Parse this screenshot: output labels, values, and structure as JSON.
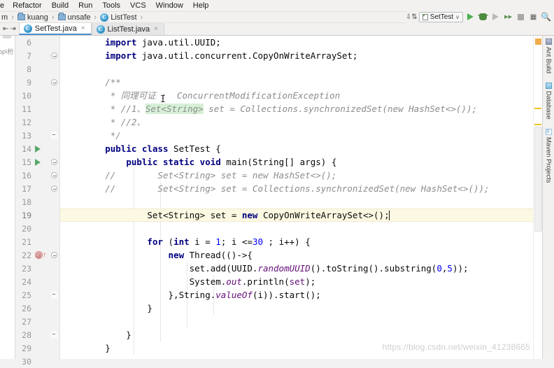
{
  "menubar": {
    "items": [
      {
        "label": "e",
        "clipped": true
      },
      {
        "label": "Refactor"
      },
      {
        "label": "Build"
      },
      {
        "label": "Run"
      },
      {
        "label": "Tools"
      },
      {
        "label": "VCS"
      },
      {
        "label": "Window"
      },
      {
        "label": "Help"
      }
    ]
  },
  "breadcrumb": {
    "items": [
      {
        "label": "m",
        "icon": "none"
      },
      {
        "label": "kuang",
        "icon": "folder-icon"
      },
      {
        "label": "unsafe",
        "icon": "folder-icon"
      },
      {
        "label": "ListTest",
        "icon": "class-icon"
      }
    ]
  },
  "tabs": {
    "items": [
      {
        "label": "SetTest.java",
        "active": true,
        "close": "×"
      },
      {
        "label": "ListTest.java",
        "active": false,
        "close": "×"
      }
    ]
  },
  "run_toolbar": {
    "sort_icon": "sort-descending-icon",
    "config_name": "SetTest",
    "config_chevron": "∨",
    "run_label": "run-icon",
    "debug_label": "debug-icon",
    "run_with_coverage": "coverage-icon",
    "profile": "profile-icon",
    "stop": "stop-icon",
    "layout": "layout-icon",
    "search": "search-icon"
  },
  "left_stripe": {
    "ghost_text": "op\\桁"
  },
  "editor": {
    "lines": [
      {
        "n": "6",
        "gutter": {
          "run": false,
          "fold": false,
          "overridden": false
        },
        "current": false,
        "tokens": [
          {
            "t": "        ",
            "c": "plain"
          },
          {
            "t": "import",
            "c": "kw"
          },
          {
            "t": " java.util.UUID;",
            "c": "plain"
          }
        ]
      },
      {
        "n": "7",
        "gutter": {
          "run": false,
          "fold": true,
          "overridden": false
        },
        "current": false,
        "tokens": [
          {
            "t": "        ",
            "c": "plain"
          },
          {
            "t": "import",
            "c": "kw"
          },
          {
            "t": " java.util.concurrent.CopyOnWriteArraySet;",
            "c": "plain"
          }
        ]
      },
      {
        "n": "8",
        "gutter": {
          "run": false,
          "fold": false,
          "overridden": false
        },
        "current": false,
        "tokens": []
      },
      {
        "n": "9",
        "gutter": {
          "run": false,
          "fold": true,
          "overridden": false
        },
        "current": false,
        "tokens": [
          {
            "t": "        /**",
            "c": "cmt"
          }
        ]
      },
      {
        "n": "10",
        "gutter": {
          "run": false,
          "fold": false,
          "overridden": false
        },
        "current": false,
        "tokens": [
          {
            "t": "         * 同理可证 :  ConcurrentModificationException",
            "c": "cmt"
          }
        ]
      },
      {
        "n": "11",
        "gutter": {
          "run": false,
          "fold": false,
          "overridden": false
        },
        "current": false,
        "tokens": [
          {
            "t": "         * //1、",
            "c": "cmt"
          },
          {
            "t": "Set<String>",
            "c": "cmt-hl"
          },
          {
            "t": " set = Collections.synchronizedSet(new HashSet<>());",
            "c": "cmt"
          }
        ]
      },
      {
        "n": "12",
        "gutter": {
          "run": false,
          "fold": false,
          "overridden": false
        },
        "current": false,
        "tokens": [
          {
            "t": "         * //2、",
            "c": "cmt"
          }
        ]
      },
      {
        "n": "13",
        "gutter": {
          "run": false,
          "fold": "tip",
          "overridden": false
        },
        "current": false,
        "tokens": [
          {
            "t": "         */",
            "c": "cmt"
          }
        ]
      },
      {
        "n": "14",
        "gutter": {
          "run": true,
          "fold": false,
          "overridden": false
        },
        "current": false,
        "tokens": [
          {
            "t": "        ",
            "c": "plain"
          },
          {
            "t": "public class",
            "c": "kw"
          },
          {
            "t": " SetTest {",
            "c": "plain"
          }
        ]
      },
      {
        "n": "15",
        "gutter": {
          "run": true,
          "fold": true,
          "overridden": false
        },
        "current": false,
        "tokens": [
          {
            "t": "            ",
            "c": "plain"
          },
          {
            "t": "public static void",
            "c": "kw"
          },
          {
            "t": " main(String[] args) {",
            "c": "plain"
          }
        ]
      },
      {
        "n": "16",
        "gutter": {
          "run": false,
          "fold": true,
          "overridden": false
        },
        "current": false,
        "tokens": [
          {
            "t": "        //        Set<String> set = new HashSet<>();",
            "c": "cmt"
          }
        ]
      },
      {
        "n": "17",
        "gutter": {
          "run": false,
          "fold": true,
          "overridden": false
        },
        "current": false,
        "tokens": [
          {
            "t": "        //        Set<String> set = Collections.synchronizedSet(new HashSet<>());",
            "c": "cmt"
          }
        ]
      },
      {
        "n": "18",
        "gutter": {
          "run": false,
          "fold": false,
          "overridden": false
        },
        "current": false,
        "tokens": []
      },
      {
        "n": "19",
        "gutter": {
          "run": false,
          "fold": false,
          "overridden": false
        },
        "current": true,
        "caret": true,
        "tokens": [
          {
            "t": "                Set<String> set = ",
            "c": "plain"
          },
          {
            "t": "new",
            "c": "kw"
          },
          {
            "t": " CopyOnWriteArraySet<>();",
            "c": "plain"
          }
        ]
      },
      {
        "n": "20",
        "gutter": {
          "run": false,
          "fold": false,
          "overridden": false
        },
        "current": false,
        "tokens": []
      },
      {
        "n": "21",
        "gutter": {
          "run": false,
          "fold": false,
          "overridden": false
        },
        "current": false,
        "tokens": [
          {
            "t": "                ",
            "c": "plain"
          },
          {
            "t": "for",
            "c": "kw"
          },
          {
            "t": " (",
            "c": "plain"
          },
          {
            "t": "int",
            "c": "kw"
          },
          {
            "t": " i = ",
            "c": "plain"
          },
          {
            "t": "1",
            "c": "num"
          },
          {
            "t": "; i <=",
            "c": "plain"
          },
          {
            "t": "30",
            "c": "num"
          },
          {
            "t": " ; i++) {",
            "c": "plain"
          }
        ]
      },
      {
        "n": "22",
        "gutter": {
          "run": false,
          "fold": true,
          "overridden": true
        },
        "current": false,
        "tokens": [
          {
            "t": "                    ",
            "c": "plain"
          },
          {
            "t": "new",
            "c": "kw"
          },
          {
            "t": " Thread(()->{",
            "c": "plain"
          }
        ]
      },
      {
        "n": "23",
        "gutter": {
          "run": false,
          "fold": false,
          "overridden": false
        },
        "current": false,
        "tokens": [
          {
            "t": "                        set.add(UUID.",
            "c": "plain"
          },
          {
            "t": "randomUUID",
            "c": "field"
          },
          {
            "t": "().toString().substring(",
            "c": "plain"
          },
          {
            "t": "0",
            "c": "num"
          },
          {
            "t": ",",
            "c": "plain"
          },
          {
            "t": "5",
            "c": "num"
          },
          {
            "t": "));",
            "c": "plain"
          }
        ]
      },
      {
        "n": "24",
        "gutter": {
          "run": false,
          "fold": false,
          "overridden": false
        },
        "current": false,
        "tokens": [
          {
            "t": "                        System.",
            "c": "plain"
          },
          {
            "t": "out",
            "c": "field"
          },
          {
            "t": ".println(",
            "c": "plain"
          },
          {
            "t": "set",
            "c": "localvar"
          },
          {
            "t": ");",
            "c": "plain"
          }
        ]
      },
      {
        "n": "25",
        "gutter": {
          "run": false,
          "fold": "tip",
          "overridden": false
        },
        "current": false,
        "tokens": [
          {
            "t": "                    },String.",
            "c": "plain"
          },
          {
            "t": "valueOf",
            "c": "field"
          },
          {
            "t": "(i)).start();",
            "c": "plain"
          }
        ]
      },
      {
        "n": "26",
        "gutter": {
          "run": false,
          "fold": false,
          "overridden": false
        },
        "current": false,
        "tokens": [
          {
            "t": "                }",
            "c": "plain"
          }
        ]
      },
      {
        "n": "27",
        "gutter": {
          "run": false,
          "fold": false,
          "overridden": false
        },
        "current": false,
        "tokens": []
      },
      {
        "n": "28",
        "gutter": {
          "run": false,
          "fold": "tip",
          "overridden": false
        },
        "current": false,
        "tokens": [
          {
            "t": "            }",
            "c": "plain"
          }
        ]
      },
      {
        "n": "29",
        "gutter": {
          "run": false,
          "fold": false,
          "overridden": false
        },
        "current": false,
        "tokens": [
          {
            "t": "        }",
            "c": "plain"
          }
        ]
      },
      {
        "n": "30",
        "gutter": {
          "run": false,
          "fold": false,
          "overridden": false
        },
        "current": false,
        "tokens": []
      }
    ]
  },
  "right_toolwindows": {
    "items": [
      {
        "label": "Ant Build",
        "icon": "ant-icon"
      },
      {
        "label": "Database",
        "icon": "database-icon"
      },
      {
        "label": "Maven Projects",
        "icon": "maven-icon"
      }
    ]
  },
  "watermark": {
    "text": "https://blog.csdn.net/weixin_41238665"
  },
  "colors": {
    "keyword": "#000080",
    "comment": "#8c8c8c",
    "number": "#0000ff",
    "field": "#660e7a",
    "current_line": "#fcf9e2",
    "accent": "#4a8fd0",
    "run_green": "#4caf50"
  }
}
